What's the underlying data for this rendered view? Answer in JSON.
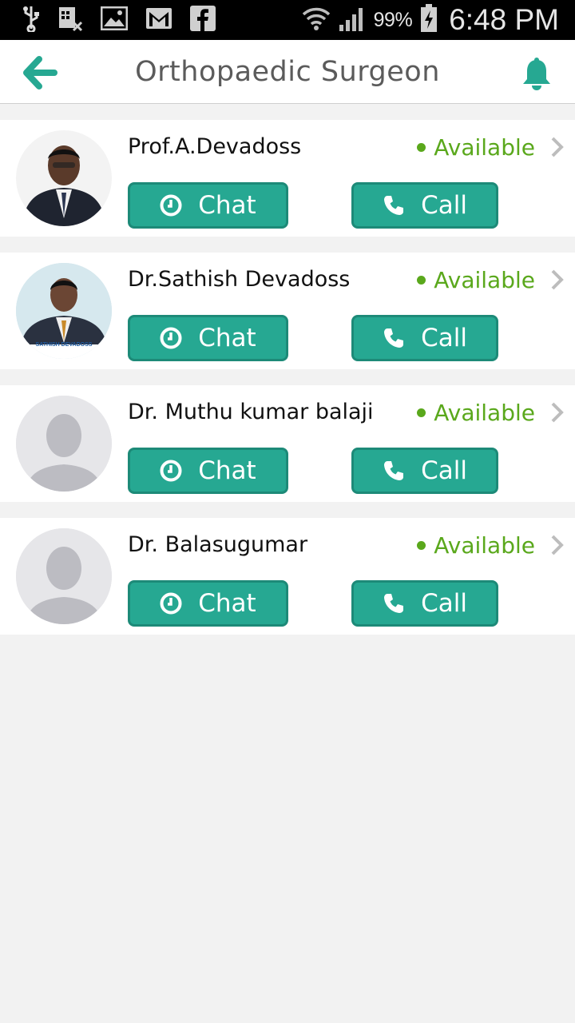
{
  "status_bar": {
    "battery": "99%",
    "time": "6:48 PM"
  },
  "header": {
    "title": "Orthopaedic Surgeon",
    "back_icon": "arrow-left-icon",
    "notification_icon": "bell-icon"
  },
  "colors": {
    "accent": "#26a892",
    "available": "#5aa81c"
  },
  "doctors": [
    {
      "name": "Prof.A.Devadoss",
      "status": "Available",
      "chat_label": "Chat",
      "call_label": "Call",
      "avatar": "photo"
    },
    {
      "name": "Dr.Sathish Devadoss",
      "status": "Available",
      "chat_label": "Chat",
      "call_label": "Call",
      "avatar": "photo",
      "avatar_caption": "SATHISH DEVADOSS"
    },
    {
      "name": "Dr. Muthu kumar balaji",
      "status": "Available",
      "chat_label": "Chat",
      "call_label": "Call",
      "avatar": "placeholder"
    },
    {
      "name": "Dr. Balasugumar",
      "status": "Available",
      "chat_label": "Chat",
      "call_label": "Call",
      "avatar": "placeholder"
    }
  ]
}
